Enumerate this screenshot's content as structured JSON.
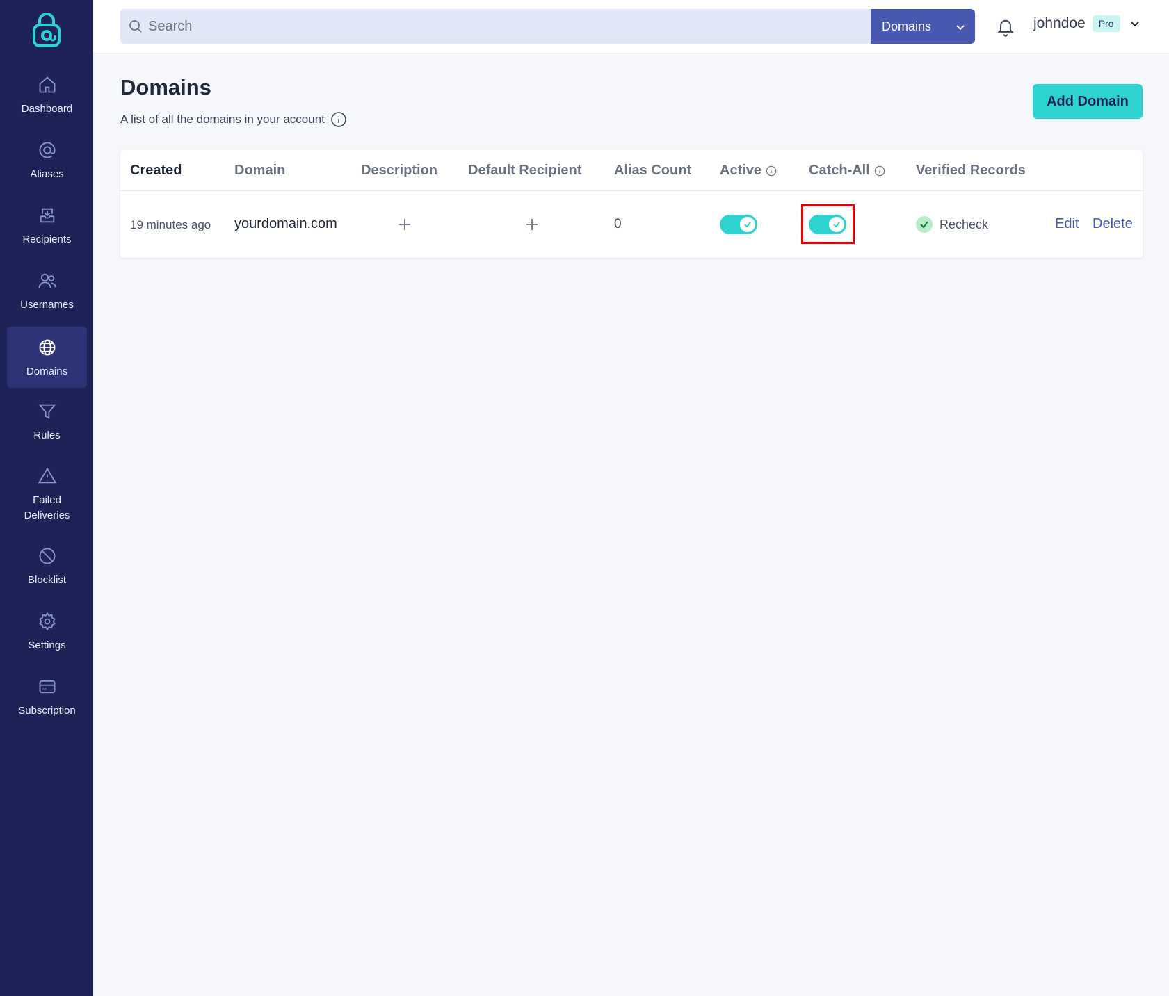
{
  "sidebar": {
    "items": [
      {
        "label": "Dashboard",
        "icon": "home-icon"
      },
      {
        "label": "Aliases",
        "icon": "at-sign-icon"
      },
      {
        "label": "Recipients",
        "icon": "inbox-icon"
      },
      {
        "label": "Usernames",
        "icon": "users-icon"
      },
      {
        "label": "Domains",
        "icon": "globe-icon",
        "active": true
      },
      {
        "label": "Rules",
        "icon": "funnel-icon"
      },
      {
        "label": "Failed Deliveries",
        "icon": "warning-icon"
      },
      {
        "label": "Blocklist",
        "icon": "ban-icon"
      },
      {
        "label": "Settings",
        "icon": "gear-icon"
      },
      {
        "label": "Subscription",
        "icon": "credit-card-icon"
      }
    ]
  },
  "header": {
    "search_placeholder": "Search",
    "search_scope": "Domains",
    "username": "johndoe",
    "plan_badge": "Pro"
  },
  "main": {
    "title": "Domains",
    "subtitle": "A list of all the domains in your account",
    "add_button": "Add Domain"
  },
  "table": {
    "headers": {
      "created": "Created",
      "domain": "Domain",
      "description": "Description",
      "default_recipient": "Default Recipient",
      "alias_count": "Alias Count",
      "active": "Active",
      "catch_all": "Catch-All",
      "verified_records": "Verified Records"
    },
    "rows": [
      {
        "created": "19 minutes ago",
        "domain": "yourdomain.com",
        "alias_count": "0",
        "active": true,
        "catch_all": true,
        "verified_label": "Recheck",
        "edit_label": "Edit",
        "delete_label": "Delete"
      }
    ]
  },
  "colors": {
    "sidebar_bg": "#1e2357",
    "accent": "#2dd4cf",
    "primary": "#4857b0",
    "highlight": "#e60000"
  }
}
